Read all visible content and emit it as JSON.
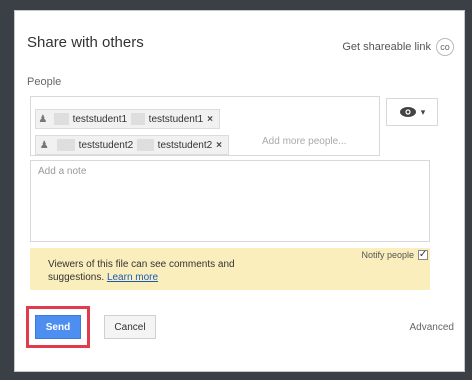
{
  "dialog": {
    "title": "Share with others",
    "shareable_link_label": "Get shareable link",
    "link_icon_glyph": "co",
    "people_label": "People",
    "recipients": [
      {
        "name_a": "teststudent1",
        "name_b": "teststudent1",
        "remove": "×"
      },
      {
        "name_a": "teststudent2",
        "name_b": "teststudent2",
        "remove": "×"
      }
    ],
    "add_more_placeholder": "Add more people...",
    "permission_icon": "eye-icon",
    "note_placeholder": "Add a note",
    "notice_text": "Viewers of this file can see comments and suggestions.",
    "learn_more": "Learn more",
    "notify_label": "Notify people",
    "notify_checked": true,
    "send_label": "Send",
    "cancel_label": "Cancel",
    "advanced_label": "Advanced"
  },
  "colors": {
    "send": "#4d8ef0",
    "highlight": "#e23b4b",
    "notice_bg": "#f9eebc"
  }
}
